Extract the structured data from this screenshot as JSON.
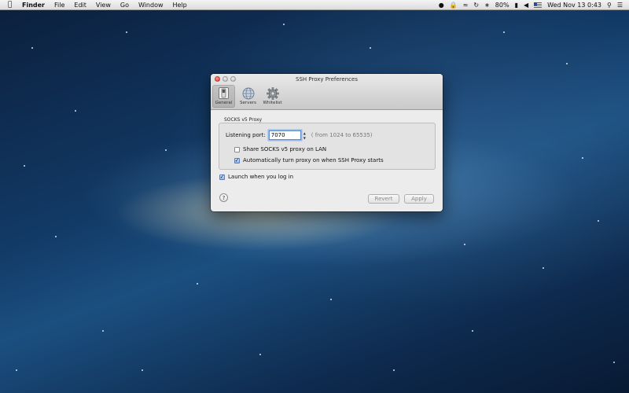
{
  "menubar": {
    "app": "Finder",
    "menus": [
      "File",
      "Edit",
      "View",
      "Go",
      "Window",
      "Help"
    ],
    "battery": "80%",
    "clock": "Wed Nov 13  0:43"
  },
  "window": {
    "title": "SSH Proxy Preferences",
    "toolbar": [
      {
        "label": "General",
        "icon": "switch-icon"
      },
      {
        "label": "Servers",
        "icon": "globe-icon"
      },
      {
        "label": "Whitelist",
        "icon": "gear-icon"
      }
    ],
    "selected_tab": "General",
    "section_title": "SOCKS v5 Proxy",
    "listening_port_label": "Listening port:",
    "listening_port_value": "7070",
    "port_hint": "( from 1024 to 65535)",
    "share_lan_label": "Share SOCKS v5 proxy on LAN",
    "share_lan_checked": false,
    "auto_turn_label": "Automatically turn proxy on when SSH Proxy starts",
    "auto_turn_checked": true,
    "launch_login_label": "Launch when you log in",
    "launch_login_checked": true,
    "help_label": "?",
    "revert_label": "Revert",
    "apply_label": "Apply"
  },
  "colors": {
    "focus_ring": "#5e8fd4",
    "close_button": "#d9362a"
  }
}
